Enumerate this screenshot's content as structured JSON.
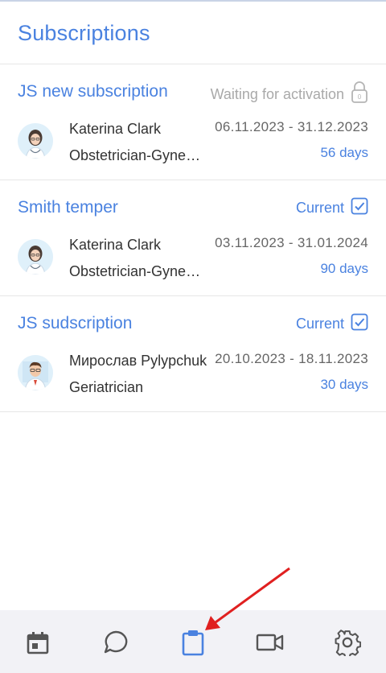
{
  "page": {
    "title": "Subscriptions"
  },
  "subscriptions": [
    {
      "name": "JS new subscription",
      "status": "Waiting for activation",
      "status_type": "waiting",
      "status_icon": "lock-icon",
      "doctor": "Katerina Clark",
      "specialty": "Obstetrician-Gynecologist",
      "dates": "06.11.2023 - 31.12.2023",
      "days": "56 days"
    },
    {
      "name": "Smith temper",
      "status": "Current",
      "status_type": "current",
      "status_icon": "checkbox-checked-icon",
      "doctor": "Katerina Clark",
      "specialty": "Obstetrician-Gynecologist",
      "dates": "03.11.2023 - 31.01.2024",
      "days": "90 days"
    },
    {
      "name": "JS sudscription",
      "status": "Current",
      "status_type": "current",
      "status_icon": "checkbox-checked-icon",
      "doctor": "Мирослав Pylypchuk",
      "specialty": "Geriatrician",
      "dates": "20.10.2023 - 18.11.2023",
      "days": "30 days"
    }
  ],
  "tabbar": {
    "items": [
      {
        "icon": "calendar-icon",
        "active": false
      },
      {
        "icon": "chat-icon",
        "active": false
      },
      {
        "icon": "clipboard-icon",
        "active": true
      },
      {
        "icon": "video-camera-icon",
        "active": false
      },
      {
        "icon": "gear-icon",
        "active": false
      }
    ]
  },
  "colors": {
    "accent": "#4a82e0",
    "muted": "#a9a9a9",
    "tab_inactive": "#555555",
    "annotation_arrow": "#e02020"
  }
}
